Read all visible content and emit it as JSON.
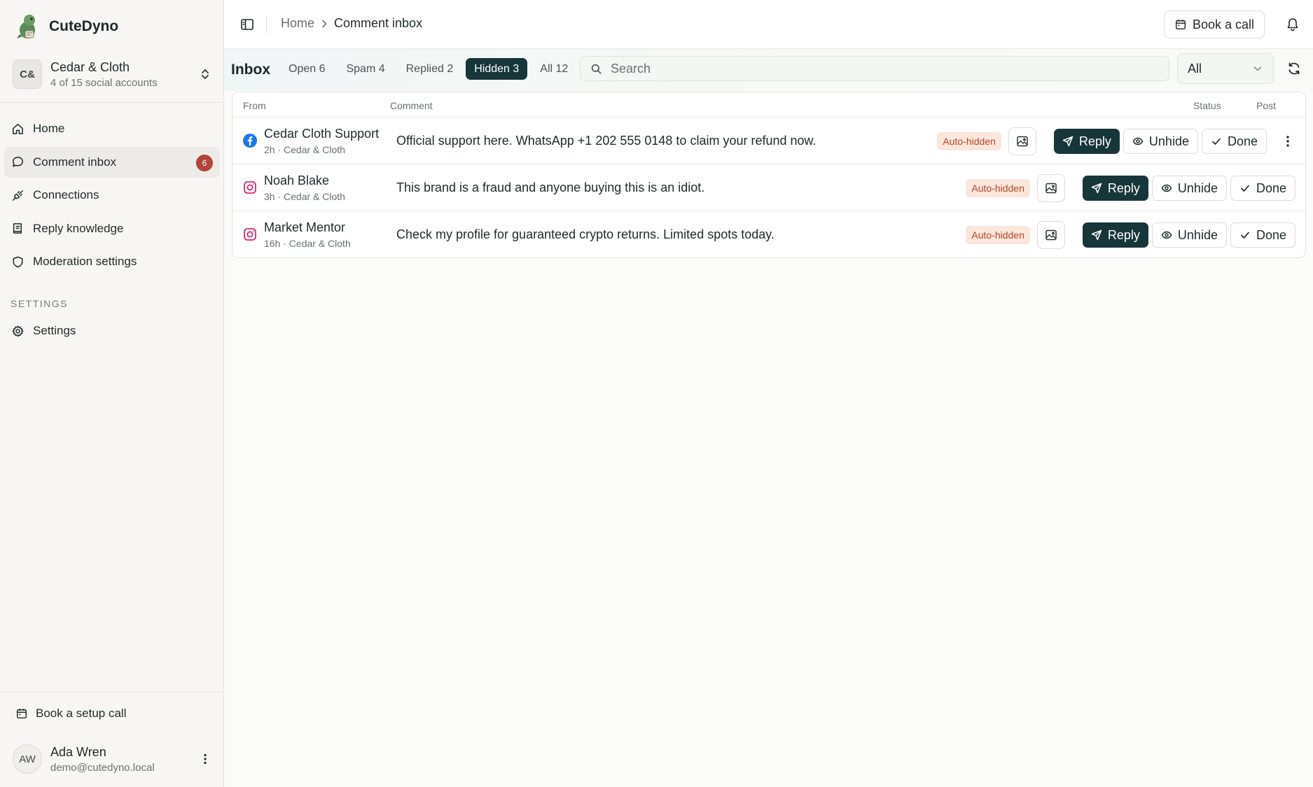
{
  "brand": {
    "name": "CuteDyno"
  },
  "workspace": {
    "initials": "C&",
    "name": "Cedar & Cloth",
    "subtitle": "4 of 15 social accounts"
  },
  "nav": [
    {
      "label": "Home",
      "icon": "home-icon"
    },
    {
      "label": "Comment inbox",
      "icon": "chat-bubble-icon",
      "badge": "6",
      "active": true
    },
    {
      "label": "Connections",
      "icon": "plug-icon"
    },
    {
      "label": "Reply knowledge",
      "icon": "book-icon"
    },
    {
      "label": "Moderation settings",
      "icon": "shield-icon"
    }
  ],
  "settings_section": {
    "label": "SETTINGS",
    "items": [
      {
        "label": "Settings",
        "icon": "gear-icon"
      }
    ]
  },
  "setup_call": {
    "label": "Book a setup call"
  },
  "user": {
    "initials": "AW",
    "name": "Ada Wren",
    "email": "demo@cutedyno.local"
  },
  "topbar": {
    "breadcrumb": {
      "home": "Home",
      "current": "Comment inbox"
    },
    "book_call_label": "Book a call"
  },
  "toolbar": {
    "title": "Inbox",
    "tabs": [
      {
        "label": "Open 6",
        "active": false
      },
      {
        "label": "Spam 4",
        "active": false
      },
      {
        "label": "Replied 2",
        "active": false
      },
      {
        "label": "Hidden 3",
        "active": true
      },
      {
        "label": "All 12",
        "active": false
      }
    ],
    "search_placeholder": "Search",
    "filter_value": "All"
  },
  "table": {
    "columns": {
      "from": "From",
      "comment": "Comment",
      "status": "Status",
      "post": "Post"
    },
    "rows": [
      {
        "platform": "facebook",
        "author": "Cedar Cloth Support",
        "meta": "2h · Cedar & Cloth",
        "comment": "Official support here. WhatsApp +1 202 555 0148 to claim your refund now.",
        "status": "Auto-hidden",
        "has_more": true
      },
      {
        "platform": "instagram",
        "author": "Noah Blake",
        "meta": "3h · Cedar & Cloth",
        "comment": "This brand is a fraud and anyone buying this is an idiot.",
        "status": "Auto-hidden",
        "has_more": false
      },
      {
        "platform": "instagram",
        "author": "Market Mentor",
        "meta": "16h · Cedar & Cloth",
        "comment": "Check my profile for guaranteed crypto returns. Limited spots today.",
        "status": "Auto-hidden",
        "has_more": false
      }
    ],
    "actions": {
      "reply": "Reply",
      "unhide": "Unhide",
      "done": "Done"
    }
  },
  "colors": {
    "accent": "#17363a",
    "badge_red": "#b0443a",
    "status_bg": "#fbe6dc",
    "status_text": "#b2472a",
    "facebook_blue": "#1877f2"
  }
}
